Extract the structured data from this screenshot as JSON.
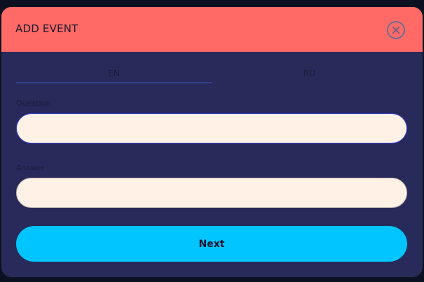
{
  "modal": {
    "title": "ADD EVENT",
    "close_icon": "close-icon"
  },
  "tabs": [
    {
      "label": "EN",
      "active": true
    },
    {
      "label": "RU",
      "active": false
    }
  ],
  "fields": {
    "question": {
      "label": "Question",
      "value": "",
      "placeholder": ""
    },
    "answer": {
      "label": "Answer",
      "value": "",
      "placeholder": ""
    }
  },
  "actions": {
    "next_label": "Next"
  },
  "colors": {
    "header_bg": "#ff6a66",
    "body_bg": "#282b59",
    "input_bg": "#fff1e6",
    "accent": "#00c5ff",
    "active_tab_underline": "#4a5be0"
  }
}
